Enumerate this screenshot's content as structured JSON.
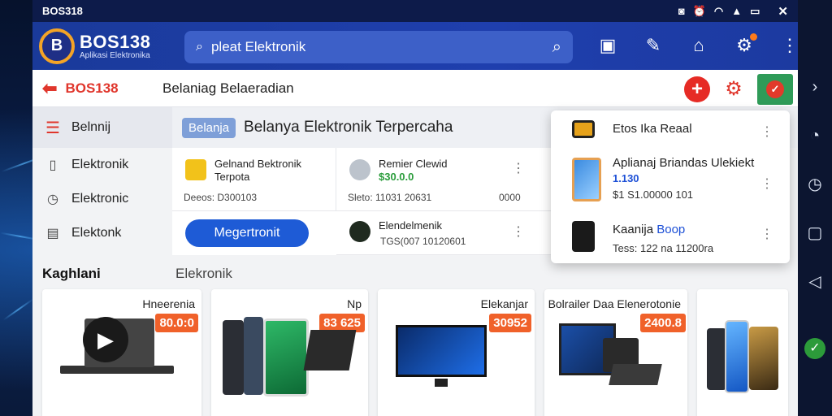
{
  "status": {
    "left": "BOS318",
    "icons": [
      "shield-icon",
      "alarm-icon",
      "wifi-icon",
      "signal-icon",
      "battery-icon",
      "close-icon"
    ]
  },
  "topbar": {
    "logo_letter": "B",
    "logo_title": "BOS138",
    "logo_subtitle": "Aplikasi Elektronika",
    "search_value": "pleat Elektronik",
    "actions": [
      "calendar-icon",
      "tools-icon",
      "account-icon",
      "settings-icon",
      "more-icon"
    ]
  },
  "subbar": {
    "back_label": "BOS138",
    "crumb": "Belaniag Belaeradian"
  },
  "sidebar": {
    "items": [
      {
        "label": "Belnnij",
        "icon": "menu-icon"
      },
      {
        "label": "Elektronik",
        "icon": "device-icon"
      },
      {
        "label": "Elektronic",
        "icon": "clock-icon"
      },
      {
        "label": "Elektonk",
        "icon": "box-icon"
      }
    ]
  },
  "main": {
    "pill": "Belanja",
    "title": "Belanya Elektronik Terpercaha",
    "cells": [
      {
        "title": "Gelnand Bektronik Terpota",
        "sub": "Deeos: D300103"
      },
      {
        "title": "Remier Clewid",
        "price": "$30.0.0",
        "sub": "Sleto: 11031 20631",
        "extra": "0000"
      },
      {
        "title": "Elendelmenik",
        "sub": "TGS(007 10120601"
      }
    ],
    "cta": "Megertronit"
  },
  "popup": {
    "items": [
      {
        "title": "Etos Ika Reaal"
      },
      {
        "title": "Aplianaj Briandas Ulekiekt",
        "price": "1.130",
        "sub": "$1 S1.00000 101"
      },
      {
        "title": "Kaanija",
        "accent": "Boop",
        "sub": "Tess: 122 na 11200ra"
      }
    ]
  },
  "section": {
    "label": "Kaghlani",
    "tab": "Elekronik"
  },
  "cards": [
    {
      "title": "Hneerenia",
      "badge": "80.0:0"
    },
    {
      "title": "Np",
      "badge": "83 625"
    },
    {
      "title": "Elekanjar",
      "badge": "30952"
    },
    {
      "title": "Bolrailer Daa Elenerotonie",
      "badge": "2400.8"
    },
    {
      "title": ""
    }
  ],
  "colors": {
    "brand": "#1f3fae",
    "accent_red": "#e0362c",
    "badge": "#f0612a",
    "cta": "#1e5bd6",
    "price_green": "#2a9c3b"
  }
}
